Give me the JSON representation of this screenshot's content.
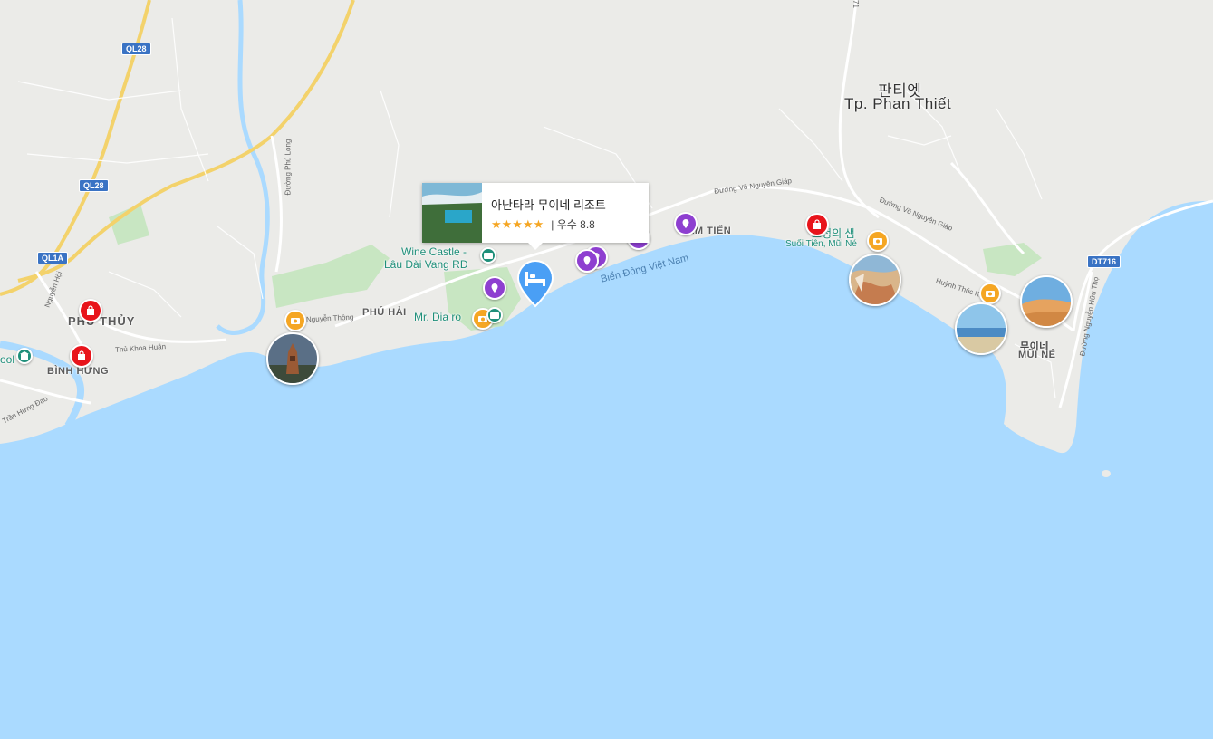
{
  "roads": {
    "ql28_a": "QL28",
    "ql28_b": "QL28",
    "ql1a": "QL1A",
    "dt716": "DT716"
  },
  "places": {
    "phu_thuy": "PHÚ THỦY",
    "binh_hung": "BÌNH HƯNG",
    "phu_hai": "PHÚ HẢI",
    "ham_tien": "HÀM TIẾN",
    "phan_thiet_ko": "판티엣",
    "phan_thiet_vi": "Tp. Phan Thiết",
    "mui_ne_ko": "무이네",
    "mui_ne_vi": "MŨI NÉ",
    "sea": "Biển Đông Việt Nam",
    "pool": "ool"
  },
  "streets": {
    "vo_nguyen_giap_1": "Đường Võ Nguyên Giáp",
    "vo_nguyen_giap_2": "Đường Võ Nguyên Giáp",
    "nguyen_thong": "Nguyễn Thông",
    "thu_khoa_huan": "Thủ Khoa Huân",
    "tran_hung_dao": "Trần Hưng Đạo",
    "huynh_thuc_khang": "Huỳnh Thúc K",
    "phu_long": "Đường Phú Long",
    "nguyen_hoi": "Nguyễn Hội",
    "nguyen_huu_tho": "Đường Nguyễn Hữu Thọ",
    "top_71": "71"
  },
  "pois": {
    "wine_castle_1": "Wine Castle -",
    "wine_castle_2": "Lâu Đài Vang RD",
    "mr_dia": "Mr. Dia ro",
    "fairy_stream_ko": "요정의 샘",
    "fairy_stream_vi": "Suối Tiên, Mũi Né"
  },
  "popup": {
    "title": "아난타라 무이네 리조트",
    "stars": "★★★★★",
    "rating": "| 우수 8.8"
  },
  "colors": {
    "water": "#aadaff",
    "land": "#ebebe8",
    "park": "#c8e6c2",
    "shopping_pin": "#e8141b",
    "attraction_pin": "#f5a623",
    "poi_pin": "#8e3fd0",
    "hotel_marker": "#4a9ff5"
  }
}
